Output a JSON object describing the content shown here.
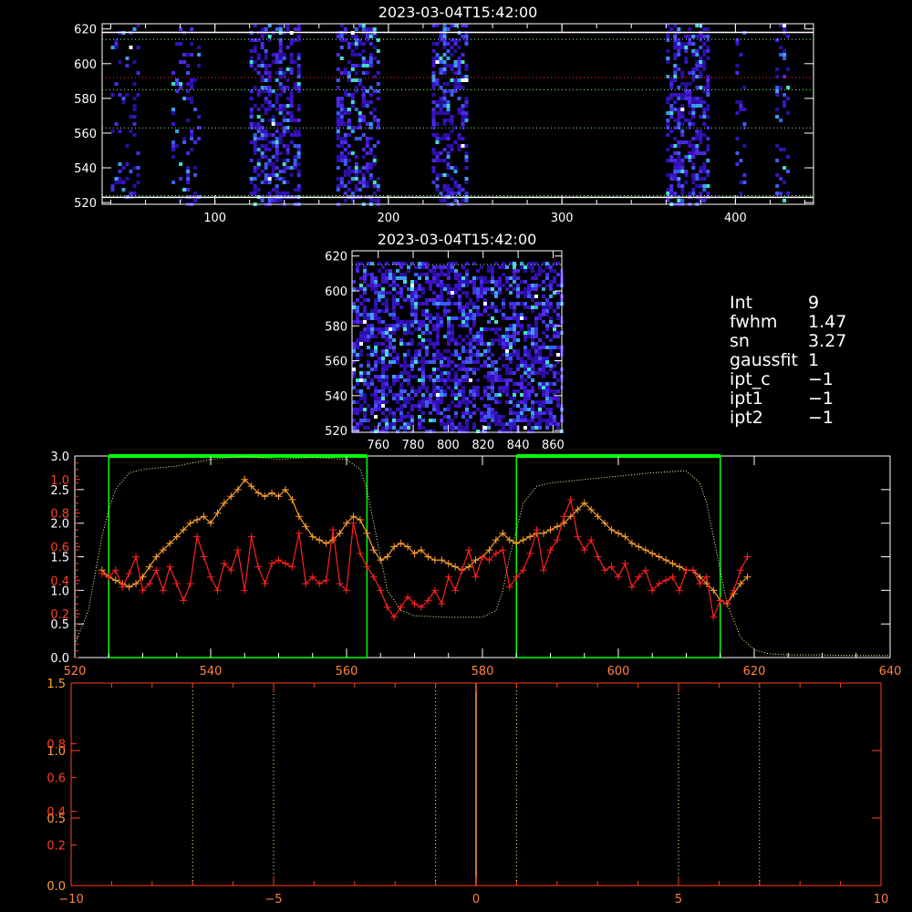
{
  "colors": {
    "bg": "#000000",
    "axis": "#ffffff",
    "red": "#ff2020",
    "orange": "#ffa030",
    "green": "#00ff00",
    "dotted": "#ffffa0",
    "yellow_dot": "#ffff80",
    "cmap": [
      "#2a0fa0",
      "#3b12c8",
      "#4a2ae6",
      "#3a5cf0",
      "#3aa0f0",
      "#40e0d0",
      "#ffffff"
    ]
  },
  "panel1": {
    "title": "2023-03-04T15:42:00",
    "xticks": [
      "100",
      "200",
      "300",
      "400"
    ],
    "yticks": [
      "520",
      "540",
      "560",
      "580",
      "600",
      "620"
    ],
    "x_range": [
      35,
      445
    ],
    "y_range": [
      519,
      623
    ],
    "hlines_white": [
      618,
      523
    ],
    "hlines_green_dotted": [
      614,
      585,
      563,
      524
    ],
    "hline_red_dotted": 592,
    "bands": [
      [
        40,
        55
      ],
      [
        75,
        90
      ],
      [
        120,
        148
      ],
      [
        170,
        195
      ],
      [
        225,
        245
      ],
      [
        360,
        385
      ],
      [
        400,
        405
      ],
      [
        423,
        430
      ]
    ]
  },
  "panel2": {
    "title": "2023-03-04T15:42:00",
    "xticks": [
      "760",
      "780",
      "800",
      "820",
      "840",
      "860"
    ],
    "yticks": [
      "520",
      "540",
      "560",
      "580",
      "600",
      "620"
    ],
    "x_range": [
      745,
      865
    ],
    "y_range": [
      519,
      623
    ]
  },
  "info": [
    {
      "k": "Int",
      "v": "9"
    },
    {
      "k": "fwhm",
      "v": "1.47"
    },
    {
      "k": "sn",
      "v": "3.27"
    },
    {
      "k": "gaussfit",
      "v": "1"
    },
    {
      "k": "ipt_c",
      "v": "−1"
    },
    {
      "k": "ipt1",
      "v": "−1"
    },
    {
      "k": "ipt2",
      "v": "−1"
    }
  ],
  "chart_data": [
    {
      "type": "line",
      "name": "spectrum-panel",
      "xlim": [
        520,
        640
      ],
      "xticks": [
        "520",
        "540",
        "560",
        "580",
        "600",
        "620",
        "640"
      ],
      "yticks_left_white": [
        "0.0",
        "0.5",
        "1.0",
        "1.5",
        "2.0",
        "2.5",
        "3.0"
      ],
      "yticks_left_red": [
        "0.2",
        "0.4",
        "0.6",
        "0.8",
        "1.0"
      ],
      "ylim": [
        0,
        3
      ],
      "green_boxes": [
        [
          525,
          563
        ],
        [
          585,
          615
        ]
      ],
      "series": [
        {
          "color": "orange",
          "x": [
            524,
            525,
            526,
            527,
            528,
            529,
            530,
            531,
            532,
            533,
            534,
            535,
            536,
            537,
            538,
            539,
            540,
            541,
            542,
            543,
            544,
            545,
            546,
            547,
            548,
            549,
            550,
            551,
            552,
            553,
            554,
            555,
            556,
            557,
            558,
            559,
            560,
            561,
            562,
            563,
            564,
            565,
            566,
            567,
            568,
            569,
            570,
            571,
            572,
            573,
            574,
            575,
            576,
            577,
            578,
            579,
            580,
            581,
            582,
            583,
            584,
            585,
            586,
            587,
            588,
            589,
            590,
            591,
            592,
            593,
            594,
            595,
            596,
            597,
            598,
            599,
            600,
            601,
            602,
            603,
            604,
            605,
            606,
            607,
            608,
            609,
            610,
            611,
            612,
            613,
            614,
            615,
            616,
            617,
            618,
            619
          ],
          "y": [
            1.3,
            1.2,
            1.15,
            1.1,
            1.05,
            1.1,
            1.2,
            1.35,
            1.5,
            1.6,
            1.7,
            1.8,
            1.9,
            2.0,
            2.05,
            2.1,
            2.0,
            2.15,
            2.3,
            2.4,
            2.5,
            2.65,
            2.55,
            2.45,
            2.4,
            2.45,
            2.4,
            2.5,
            2.35,
            2.1,
            1.95,
            1.8,
            1.75,
            1.7,
            1.75,
            1.85,
            2.0,
            2.1,
            2.05,
            1.85,
            1.6,
            1.45,
            1.5,
            1.65,
            1.7,
            1.65,
            1.55,
            1.6,
            1.5,
            1.45,
            1.45,
            1.4,
            1.35,
            1.3,
            1.35,
            1.45,
            1.5,
            1.6,
            1.75,
            1.85,
            1.75,
            1.7,
            1.75,
            1.8,
            1.85,
            1.85,
            1.9,
            1.95,
            2.0,
            2.1,
            2.2,
            2.3,
            2.2,
            2.1,
            2.0,
            1.9,
            1.85,
            1.8,
            1.7,
            1.65,
            1.6,
            1.55,
            1.5,
            1.45,
            1.4,
            1.35,
            1.3,
            1.3,
            1.2,
            1.1,
            1.0,
            0.85,
            0.8,
            0.95,
            1.1,
            1.2
          ]
        },
        {
          "color": "red",
          "x": [
            524,
            525,
            526,
            527,
            528,
            529,
            530,
            531,
            532,
            533,
            534,
            535,
            536,
            537,
            538,
            539,
            540,
            541,
            542,
            543,
            544,
            545,
            546,
            547,
            548,
            549,
            550,
            551,
            552,
            553,
            554,
            555,
            556,
            557,
            558,
            559,
            560,
            561,
            562,
            563,
            564,
            565,
            566,
            567,
            568,
            569,
            570,
            571,
            572,
            573,
            574,
            575,
            576,
            577,
            578,
            579,
            580,
            581,
            582,
            583,
            584,
            585,
            586,
            587,
            588,
            589,
            590,
            591,
            592,
            593,
            594,
            595,
            596,
            597,
            598,
            599,
            600,
            601,
            602,
            603,
            604,
            605,
            606,
            607,
            608,
            609,
            610,
            611,
            612,
            613,
            614,
            615,
            616,
            617,
            618,
            619
          ],
          "y": [
            1.25,
            1.2,
            1.3,
            1.05,
            1.25,
            1.5,
            1.0,
            1.1,
            1.3,
            1.0,
            1.35,
            1.1,
            0.85,
            1.1,
            1.8,
            1.5,
            1.2,
            1.0,
            1.4,
            1.3,
            1.6,
            1.0,
            1.8,
            1.35,
            1.1,
            1.4,
            1.45,
            1.4,
            1.35,
            1.85,
            1.1,
            1.2,
            1.1,
            1.15,
            1.9,
            1.1,
            1.0,
            2.0,
            1.55,
            1.35,
            1.2,
            1.0,
            0.75,
            0.6,
            0.75,
            0.9,
            0.8,
            0.75,
            0.85,
            1.0,
            0.8,
            1.2,
            1.0,
            1.3,
            1.6,
            1.2,
            1.5,
            1.45,
            1.55,
            1.6,
            1.05,
            1.2,
            1.3,
            1.55,
            1.9,
            1.3,
            1.6,
            1.75,
            2.1,
            2.35,
            1.8,
            1.6,
            1.75,
            1.5,
            1.3,
            1.35,
            1.2,
            1.4,
            1.05,
            1.2,
            1.3,
            1.0,
            1.1,
            1.15,
            1.2,
            1.0,
            1.3,
            1.3,
            1.1,
            1.2,
            0.6,
            0.85,
            0.8,
            1.0,
            1.3,
            1.5
          ]
        },
        {
          "color": "dotted",
          "x": [
            520,
            522,
            524,
            525,
            526,
            528,
            530,
            535,
            540,
            545,
            550,
            555,
            560,
            562,
            563,
            564,
            565,
            566,
            568,
            570,
            575,
            580,
            582,
            583,
            584,
            585,
            586,
            588,
            590,
            595,
            600,
            605,
            610,
            612,
            613,
            614,
            615,
            616,
            618,
            620,
            622,
            625,
            630,
            635,
            640
          ],
          "y": [
            0.2,
            0.7,
            1.8,
            2.2,
            2.5,
            2.75,
            2.8,
            2.85,
            2.95,
            3.0,
            2.95,
            2.98,
            2.95,
            2.8,
            2.5,
            2.0,
            1.5,
            1.0,
            0.7,
            0.62,
            0.6,
            0.6,
            0.7,
            1.0,
            1.5,
            1.9,
            2.3,
            2.55,
            2.6,
            2.65,
            2.7,
            2.75,
            2.78,
            2.6,
            2.3,
            1.8,
            1.3,
            0.8,
            0.3,
            0.12,
            0.06,
            0.04,
            0.04,
            0.03,
            0.03
          ]
        }
      ]
    },
    {
      "type": "line",
      "name": "offset-panel",
      "xlim": [
        -10,
        10
      ],
      "xticks": [
        "−10",
        "−5",
        "0",
        "5",
        "10"
      ],
      "yticks_left_white": [
        "0.0",
        "0.5",
        "1.0",
        "1.5"
      ],
      "yticks_left_red": [
        "0.2",
        "0.4",
        "0.6",
        "0.8"
      ],
      "ylim": [
        0,
        1.5
      ],
      "vlines_dotted": [
        -7,
        -5,
        -1,
        1,
        5,
        7
      ],
      "vline_orange": 0
    }
  ]
}
